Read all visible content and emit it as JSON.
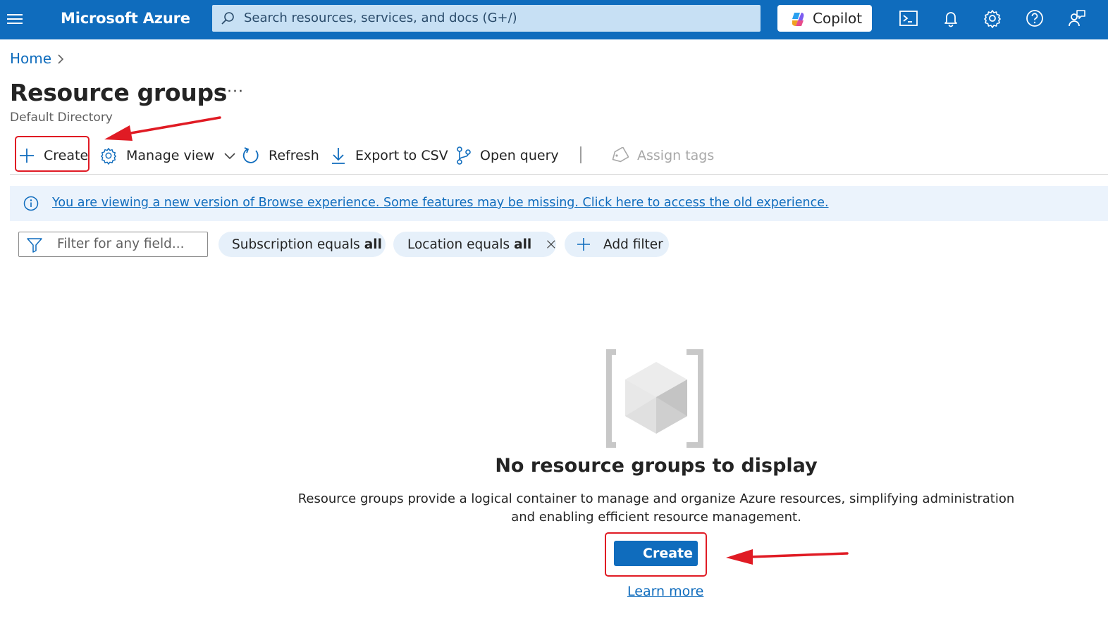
{
  "topbar": {
    "brand": "Microsoft Azure",
    "search_placeholder": "Search resources, services, and docs (G+/)",
    "copilot_label": "Copilot",
    "icons": [
      "menu-icon",
      "cloud-shell-icon",
      "notifications-icon",
      "settings-icon",
      "help-icon",
      "feedback-icon"
    ]
  },
  "breadcrumb": {
    "home": "Home"
  },
  "page": {
    "title": "Resource groups",
    "more": "···",
    "subtitle": "Default Directory"
  },
  "toolbar": {
    "create": "Create",
    "manage_view": "Manage view",
    "refresh": "Refresh",
    "export_csv": "Export to CSV",
    "open_query": "Open query",
    "assign_tags": "Assign tags"
  },
  "banner": {
    "text": "You are viewing a new version of Browse experience. Some features may be missing. Click here to access the old experience."
  },
  "filters": {
    "placeholder": "Filter for any field...",
    "subscription_label": "Subscription equals",
    "subscription_value": "all",
    "location_label": "Location equals",
    "location_value": "all",
    "add_filter": "Add filter"
  },
  "empty_state": {
    "title": "No resource groups to display",
    "description": "Resource groups provide a logical container to manage and organize Azure resources, simplifying administration and enabling efficient resource management.",
    "create_button": "Create",
    "learn_more": "Learn more"
  },
  "colors": {
    "azure_blue": "#0f6cbd",
    "annotation_red": "#e01b24"
  }
}
